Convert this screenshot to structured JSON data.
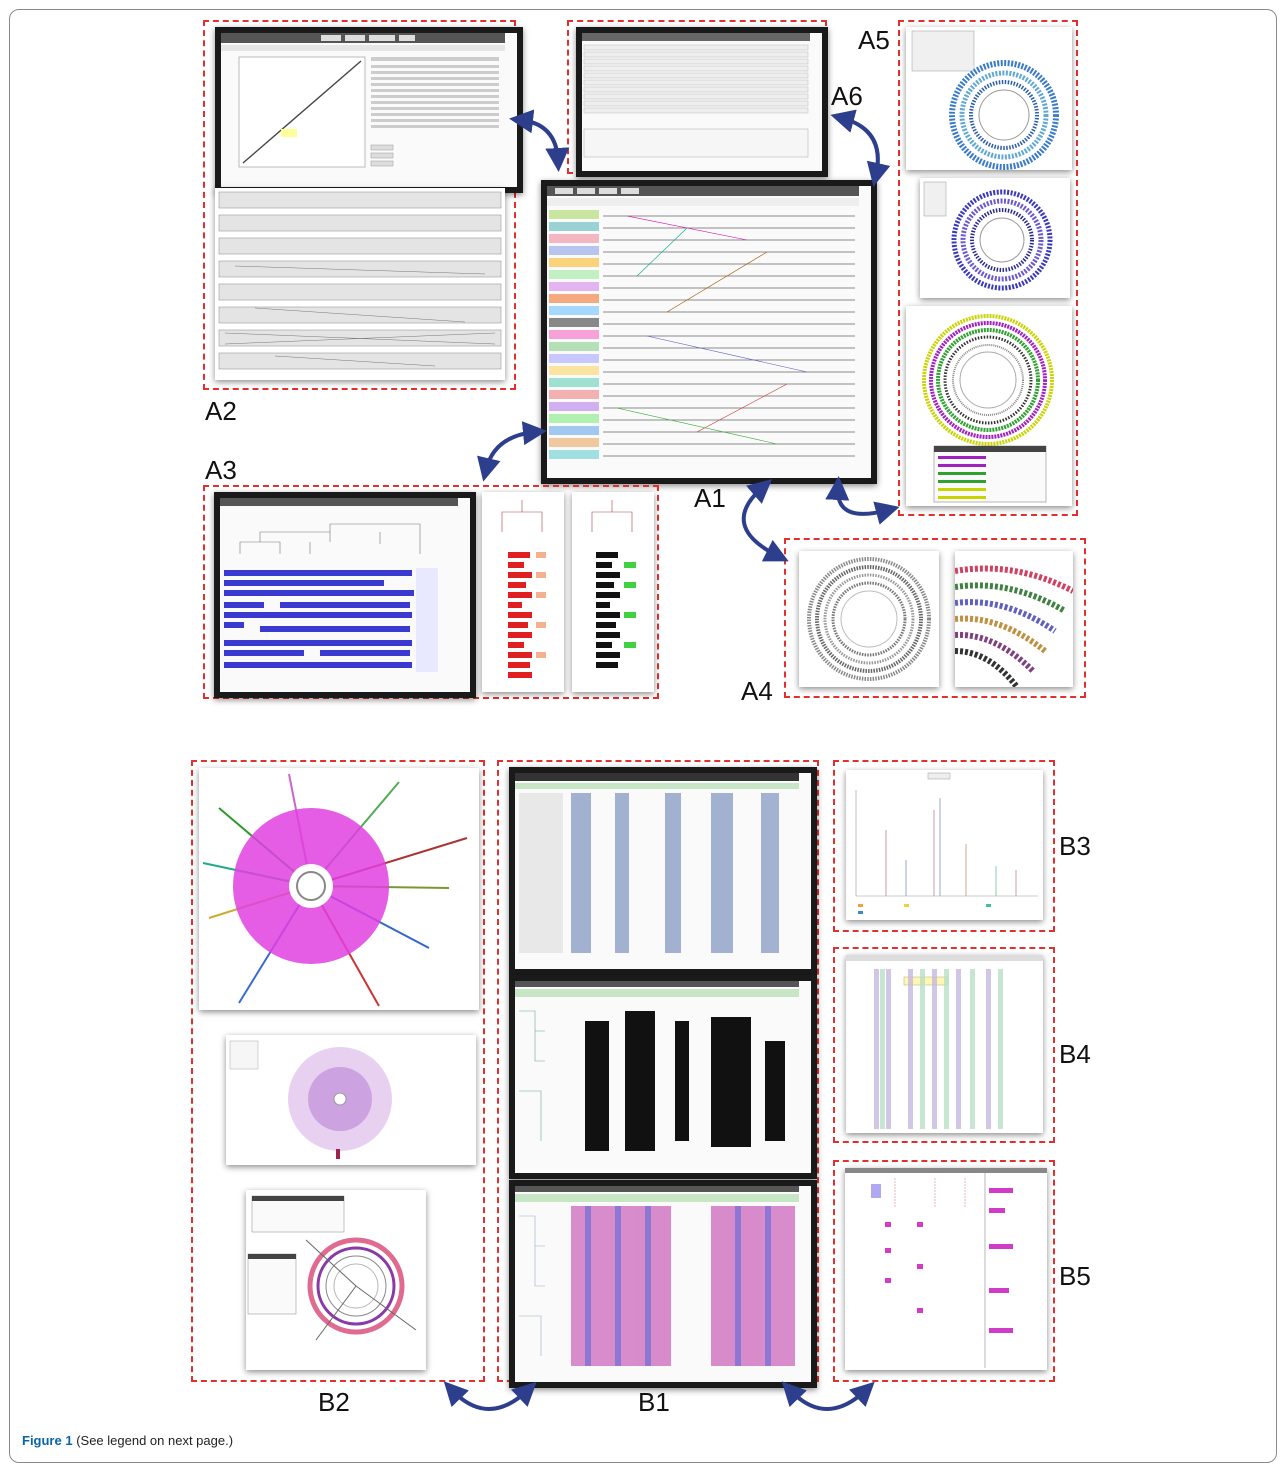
{
  "labels": {
    "A1": "A1",
    "A2": "A2",
    "A3": "A3",
    "A4": "A4",
    "A5": "A5",
    "A6": "A6",
    "B1": "B1",
    "B2": "B2",
    "B3": "B3",
    "B4": "B4",
    "B5": "B5"
  },
  "caption": {
    "title": "Figure 1",
    "text": " (See legend on next page.)"
  },
  "colors": {
    "dashed_border": "#e03030",
    "arrow": "#2c3e8c",
    "caption_title": "#0b63a8",
    "frame": "#8a8a8a"
  },
  "icons": [
    "double-headed-curved-arrow-icon"
  ]
}
